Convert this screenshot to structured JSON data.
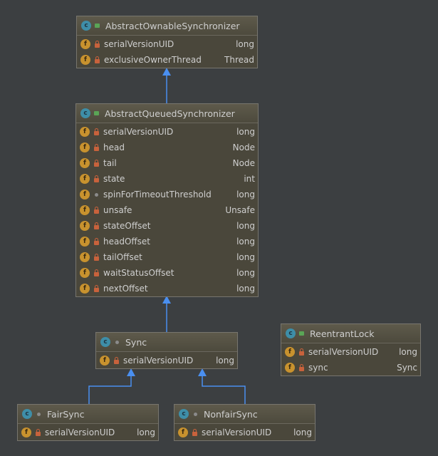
{
  "colors": {
    "background": "#3c3f41",
    "arrow": "#4a8ff0",
    "class_icon": "#3e8ea8",
    "field_icon": "#c8922e",
    "private_lock": "#c8623c"
  },
  "classes": [
    {
      "id": "aos",
      "name": "AbstractOwnableSynchronizer",
      "visibility": "public",
      "fields": [
        {
          "name": "serialVersionUID",
          "type": "long",
          "visibility": "private"
        },
        {
          "name": "exclusiveOwnerThread",
          "type": "Thread",
          "visibility": "private"
        }
      ]
    },
    {
      "id": "aqs",
      "name": "AbstractQueuedSynchronizer",
      "visibility": "public",
      "fields": [
        {
          "name": "serialVersionUID",
          "type": "long",
          "visibility": "private"
        },
        {
          "name": "head",
          "type": "Node",
          "visibility": "private"
        },
        {
          "name": "tail",
          "type": "Node",
          "visibility": "private"
        },
        {
          "name": "state",
          "type": "int",
          "visibility": "private"
        },
        {
          "name": "spinForTimeoutThreshold",
          "type": "long",
          "visibility": "package"
        },
        {
          "name": "unsafe",
          "type": "Unsafe",
          "visibility": "private"
        },
        {
          "name": "stateOffset",
          "type": "long",
          "visibility": "private"
        },
        {
          "name": "headOffset",
          "type": "long",
          "visibility": "private"
        },
        {
          "name": "tailOffset",
          "type": "long",
          "visibility": "private"
        },
        {
          "name": "waitStatusOffset",
          "type": "long",
          "visibility": "private"
        },
        {
          "name": "nextOffset",
          "type": "long",
          "visibility": "private"
        }
      ]
    },
    {
      "id": "sync",
      "name": "Sync",
      "visibility": "package",
      "fields": [
        {
          "name": "serialVersionUID",
          "type": "long",
          "visibility": "private"
        }
      ]
    },
    {
      "id": "rl",
      "name": "ReentrantLock",
      "visibility": "public",
      "fields": [
        {
          "name": "serialVersionUID",
          "type": "long",
          "visibility": "private"
        },
        {
          "name": "sync",
          "type": "Sync",
          "visibility": "private"
        }
      ]
    },
    {
      "id": "fair",
      "name": "FairSync",
      "visibility": "package",
      "fields": [
        {
          "name": "serialVersionUID",
          "type": "long",
          "visibility": "private"
        }
      ]
    },
    {
      "id": "nonfair",
      "name": "NonfairSync",
      "visibility": "package",
      "fields": [
        {
          "name": "serialVersionUID",
          "type": "long",
          "visibility": "private"
        }
      ]
    }
  ],
  "relations": [
    {
      "from": "AbstractQueuedSynchronizer",
      "to": "AbstractOwnableSynchronizer",
      "kind": "extends"
    },
    {
      "from": "Sync",
      "to": "AbstractQueuedSynchronizer",
      "kind": "extends"
    },
    {
      "from": "FairSync",
      "to": "Sync",
      "kind": "extends"
    },
    {
      "from": "NonfairSync",
      "to": "Sync",
      "kind": "extends"
    }
  ]
}
